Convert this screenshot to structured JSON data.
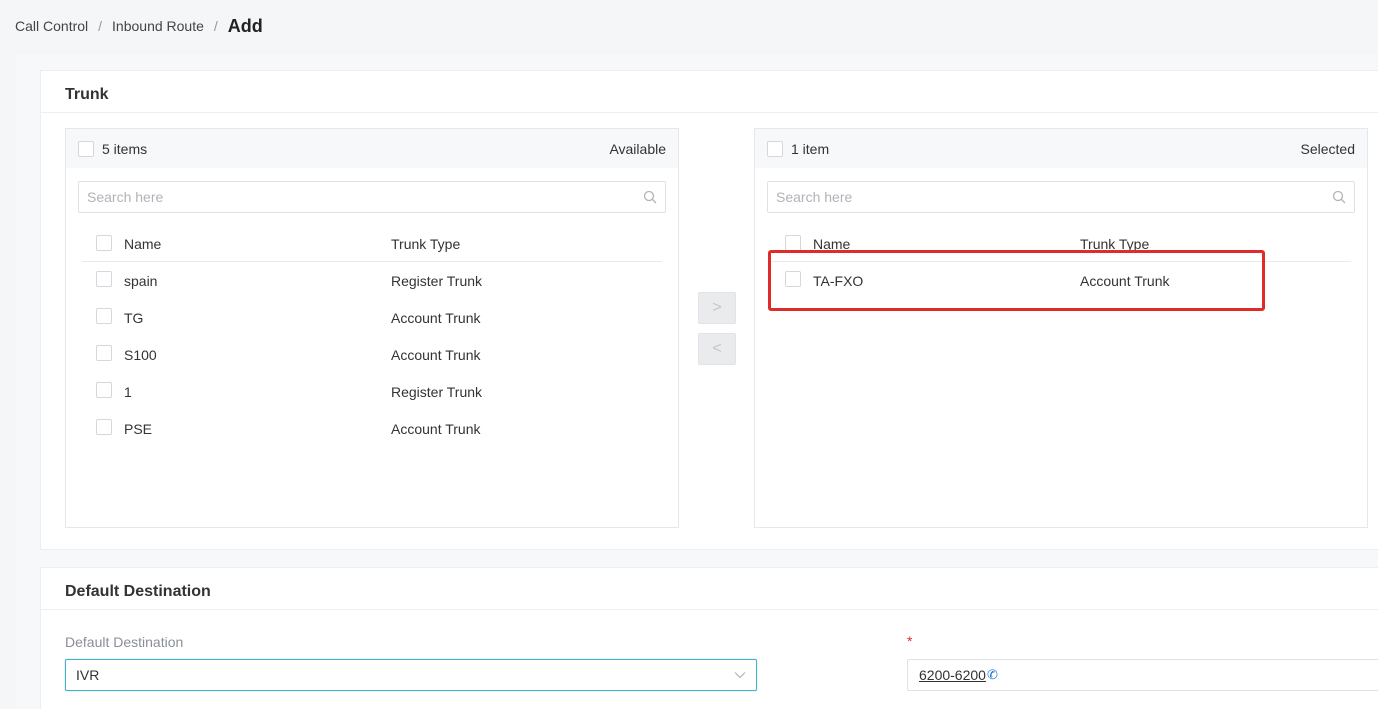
{
  "breadcrumb": {
    "items": [
      "Call Control",
      "Inbound Route"
    ],
    "separator": "/",
    "current": "Add"
  },
  "trunk_panel": {
    "title": "Trunk",
    "available": {
      "count_label": "5 items",
      "title": "Available",
      "search_placeholder": "Search here",
      "columns": {
        "name": "Name",
        "type": "Trunk Type"
      },
      "rows": [
        {
          "name": "spain",
          "type": "Register Trunk"
        },
        {
          "name": "TG",
          "type": "Account Trunk"
        },
        {
          "name": "S100",
          "type": "Account Trunk"
        },
        {
          "name": "1",
          "type": "Register Trunk"
        },
        {
          "name": "PSE",
          "type": "Account Trunk"
        }
      ]
    },
    "selected": {
      "count_label": "1 item",
      "title": "Selected",
      "search_placeholder": "Search here",
      "columns": {
        "name": "Name",
        "type": "Trunk Type"
      },
      "rows": [
        {
          "name": "TA-FXO",
          "type": "Account Trunk"
        }
      ]
    },
    "move_right_label": ">",
    "move_left_label": "<",
    "highlight_color": "#e02b2b"
  },
  "destination_panel": {
    "title": "Default Destination",
    "field_label": "Default Destination",
    "selected_value": "IVR",
    "required_marker": "*",
    "extension_value": "6200-6200",
    "phone_glyph": "✆"
  },
  "colors": {
    "accent": "#4ab0c7",
    "link": "#1e6fd9",
    "required": "#e02b2b"
  }
}
